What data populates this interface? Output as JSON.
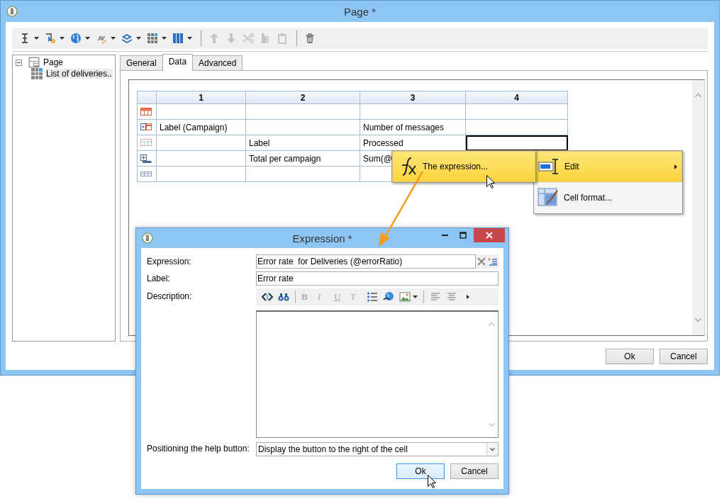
{
  "window": {
    "title": "Page *"
  },
  "toolbar": [
    {
      "kind": "text-cursor",
      "menu": true,
      "disabled": false
    },
    {
      "kind": "field-gear",
      "menu": true,
      "disabled": false
    },
    {
      "kind": "globe",
      "menu": true,
      "disabled": false
    },
    {
      "kind": "link",
      "menu": true,
      "disabled": false
    },
    {
      "kind": "layers",
      "menu": true,
      "disabled": false
    },
    {
      "kind": "grid",
      "menu": true,
      "disabled": false
    },
    {
      "kind": "columns",
      "menu": true,
      "disabled": false
    },
    {
      "kind": "separator"
    },
    {
      "kind": "up",
      "disabled": true
    },
    {
      "kind": "down",
      "disabled": true
    },
    {
      "kind": "cut",
      "disabled": true
    },
    {
      "kind": "copy",
      "disabled": true
    },
    {
      "kind": "paste",
      "disabled": true
    },
    {
      "kind": "separator"
    },
    {
      "kind": "trash",
      "disabled": false
    }
  ],
  "tree": [
    {
      "label": "Page",
      "kind": "page",
      "expanded": true,
      "selected": false,
      "children": [
        {
          "label": "List of deliveries..",
          "kind": "table",
          "selected": true
        }
      ]
    }
  ],
  "tabs": [
    {
      "label": "General",
      "selected": false
    },
    {
      "label": "Data",
      "selected": true
    },
    {
      "label": "Advanced",
      "selected": false
    }
  ],
  "grid": {
    "columns": [
      "1",
      "2",
      "3",
      "4"
    ],
    "rows": [
      {
        "kind": "header",
        "cells": [
          {
            "selected": false
          },
          {
            "selected": false
          },
          {
            "selected": false
          },
          {
            "selected": false
          }
        ]
      },
      {
        "kind": "group",
        "cells": [
          {
            "text": "Label (Campaign)",
            "selected": false
          },
          {
            "selected": false
          },
          {
            "text": "Number of messages",
            "selected": false
          },
          {
            "selected": false
          }
        ]
      },
      {
        "kind": "line",
        "cells": [
          {
            "selected": false
          },
          {
            "text": "Label",
            "selected": false
          },
          {
            "text": "Processed",
            "selected": false
          },
          {
            "selected": true
          }
        ]
      },
      {
        "kind": "total",
        "cells": [
          {
            "selected": false
          },
          {
            "text": "Total per campaign",
            "selected": false
          },
          {
            "text": "Sum(@",
            "selected": false
          },
          {}
        ]
      },
      {
        "kind": "empty",
        "cells": [
          {
            "selected": false
          },
          {
            "selected": false
          },
          {
            "selected": false
          },
          {}
        ]
      }
    ]
  },
  "context_menu": [
    {
      "kind": "expression",
      "label": "The expression...",
      "highlighted": true
    }
  ],
  "submenu": [
    {
      "kind": "edit",
      "label": "Edit",
      "highlighted": true,
      "submenu": true
    },
    {
      "kind": "format",
      "label": "Cell format...",
      "highlighted": false
    }
  ],
  "buttons": [
    {
      "label": "Ok",
      "focused": false
    },
    {
      "label": "Cancel",
      "focused": false
    }
  ],
  "dialog": {
    "title": "Expression *",
    "fields": [
      {
        "kind": "expression",
        "label": "Expression:",
        "value": "Error rate  for Deliveries (@errorRatio)"
      },
      {
        "kind": "text",
        "label": "Label:",
        "value": "Error rate"
      },
      {
        "kind": "editor",
        "label": "Description:",
        "tools": [
          {
            "kind": "source"
          },
          {
            "kind": "binoculars"
          },
          {
            "kind": "separator"
          },
          {
            "kind": "letter",
            "glyph": "B",
            "disabled": true
          },
          {
            "kind": "letter",
            "glyph": "I",
            "disabled": true
          },
          {
            "kind": "letter",
            "glyph": "U",
            "disabled": true
          },
          {
            "kind": "letter",
            "glyph": "T",
            "disabled": true
          },
          {
            "kind": "list"
          },
          {
            "kind": "globe"
          },
          {
            "kind": "image"
          },
          {
            "kind": "separator"
          },
          {
            "kind": "align-left"
          },
          {
            "kind": "align-center"
          },
          {
            "kind": "more"
          }
        ]
      },
      {
        "kind": "dropdown",
        "label": "Positioning the help button:",
        "value": "Display the button to the right of the cell"
      }
    ],
    "buttons": [
      {
        "label": "Ok",
        "focused": true
      },
      {
        "label": "Cancel",
        "focused": false
      }
    ]
  }
}
